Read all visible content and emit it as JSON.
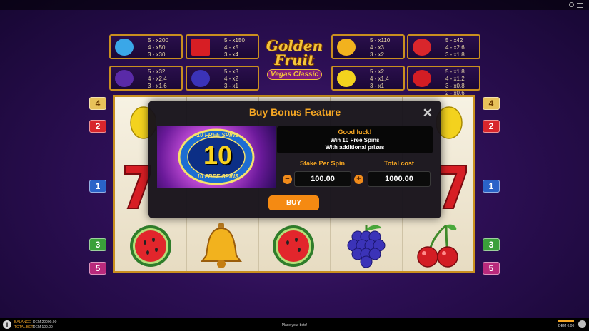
{
  "colors": {
    "gold": "#c98f1f",
    "orange": "#f58a12",
    "title": "#f5a623",
    "background": "#2d0f55"
  },
  "logo": {
    "line1": "Golden",
    "line2": "Fruit",
    "line3": "Vegas Classic"
  },
  "paytable": [
    {
      "symbol": "diamond-icon",
      "lines": [
        "5 - x200",
        "4 - x50",
        "3 - x30"
      ]
    },
    {
      "symbol": "seven-icon",
      "lines": [
        "5 - x150",
        "4 - x5",
        "3 - x4"
      ]
    },
    {
      "symbol": "bell-icon",
      "lines": [
        "5 - x110",
        "4 - x3",
        "3 - x2"
      ]
    },
    {
      "symbol": "watermelon-icon",
      "lines": [
        "5 - x42",
        "4 - x2.6",
        "3 - x1.8"
      ]
    },
    {
      "symbol": "plum-icon",
      "lines": [
        "5 - x32",
        "4 - x2.4",
        "3 - x1.6"
      ]
    },
    {
      "symbol": "grapes-icon",
      "lines": [
        "5 - x3",
        "4 - x2",
        "3 - x1"
      ]
    },
    {
      "symbol": "lemon-icon",
      "lines": [
        "5 - x2",
        "4 - x1.4",
        "3 - x1"
      ]
    },
    {
      "symbol": "cherries-icon",
      "lines": [
        "5 - x1.8",
        "4 - x1.2",
        "3 - x0.8",
        "2 - x0.6"
      ]
    }
  ],
  "paylines": {
    "left": [
      "4",
      "2",
      "1",
      "3",
      "5"
    ],
    "right": [
      "4",
      "2",
      "1",
      "3",
      "5"
    ]
  },
  "modal": {
    "title": "Buy Bonus Feature",
    "close": "✕",
    "badge_top": "10 FREE SPINS",
    "badge_number": "10",
    "badge_bottom": "10 FREE SPINS",
    "good_luck": "Good luck!",
    "win_text": "Win 10 Free Spins",
    "prize_text": "With additional prizes",
    "stake_label": "Stake Per Spin",
    "stake_value": "100.00",
    "total_label": "Total cost",
    "total_value": "1000.00",
    "minus": "−",
    "plus": "+",
    "buy": "BUY"
  },
  "footer": {
    "info": "i",
    "balance_label": "BALANCE",
    "balance_value": "DEM 20000.00",
    "totalbet_label": "TOTAL BET",
    "totalbet_value": "DEM 100.00",
    "center": "Place your bets!",
    "win_value": "DEM 0.00"
  }
}
